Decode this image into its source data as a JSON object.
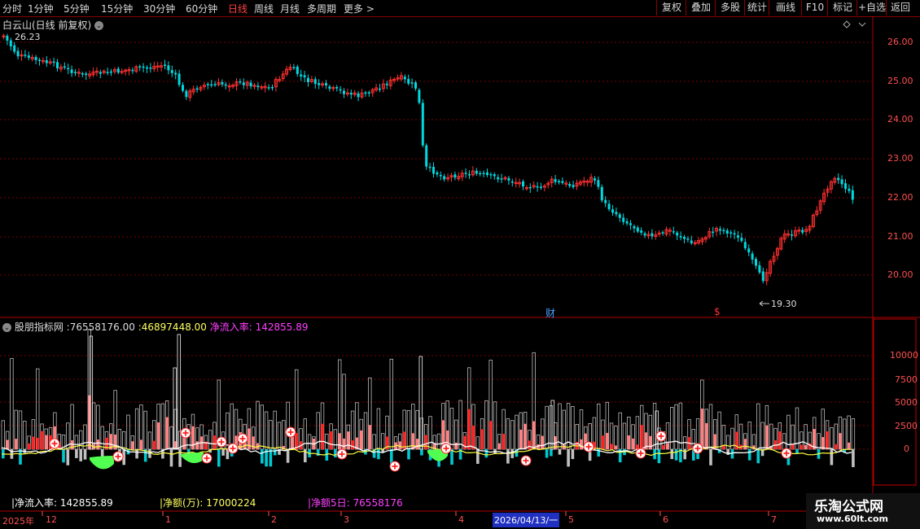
{
  "toolbar": {
    "periods": [
      "分时",
      "1分钟",
      "5分钟",
      "15分钟",
      "30分钟",
      "60分钟",
      "日线",
      "周线",
      "月线",
      "多周期",
      "更多 >"
    ],
    "active_index": 6,
    "right_buttons": [
      "复权",
      "叠加",
      "多股",
      "统计",
      "画线",
      "F10",
      "标记",
      "+自选",
      "返回"
    ]
  },
  "main_chart": {
    "title": "白云山(日线 前复权)",
    "high_label": "26.23",
    "low_label": "19.30",
    "y_ticks": [
      "26.00",
      "25.00",
      "24.00",
      "23.00",
      "22.00",
      "21.00",
      "20.00"
    ],
    "markers": [
      "财",
      "$"
    ]
  },
  "indicator": {
    "title": "股朋指标网",
    "values": [
      ":76558176.00",
      ":46897448.00",
      "净流入率: 142855.89"
    ],
    "y_ticks": [
      "10000",
      "7500",
      "5000",
      "2500",
      "0"
    ],
    "bottom_labels": [
      "净流入率: 142855.89",
      "净额(万): 17000224",
      "净额5日: 76558176"
    ]
  },
  "date_axis": {
    "year_label": "2025年",
    "months": [
      "12",
      "1",
      "2",
      "3",
      "4",
      "5",
      "6",
      "7"
    ],
    "cursor_date": "2026/04/13/一"
  },
  "watermark": {
    "title": "乐淘公式网",
    "url": "www.60lt.com"
  },
  "colors": {
    "up": "#ff3030",
    "down": "#00d8e0",
    "grid": "#7a0000",
    "label_yellow": "#ffff60",
    "label_magenta": "#ff40ff"
  }
}
